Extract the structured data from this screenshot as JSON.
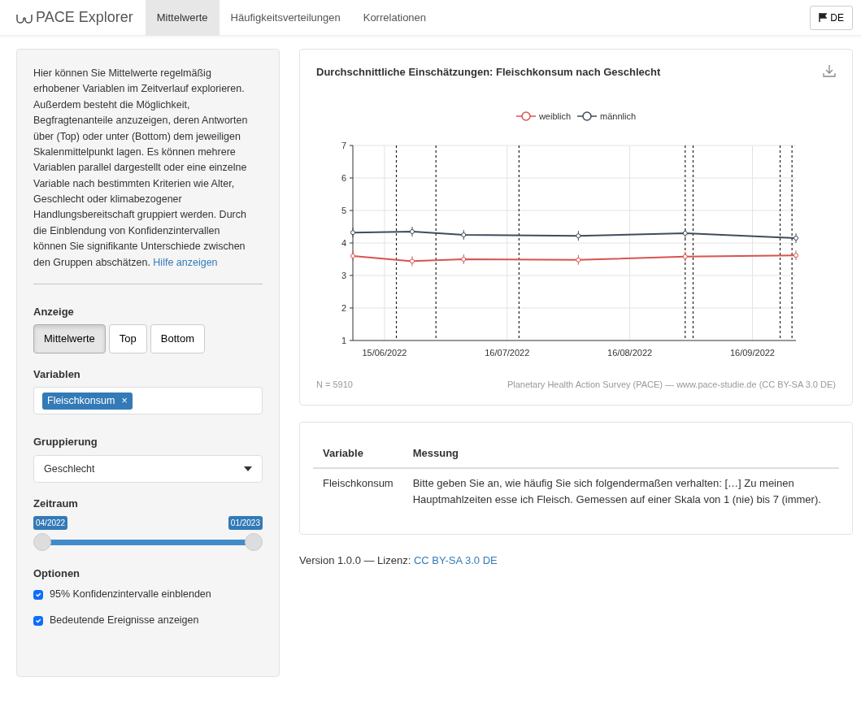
{
  "navbar": {
    "brand": "PACE Explorer",
    "tabs": [
      {
        "label": "Mittelwerte",
        "selected": true
      },
      {
        "label": "Häufigkeitsverteilungen",
        "selected": false
      },
      {
        "label": "Korrelationen",
        "selected": false
      }
    ],
    "language_button": "DE"
  },
  "sidebar": {
    "intro": "Hier können Sie Mittelwerte regelmäßig erhobener Variablen im Zeitverlauf explorieren. Außerdem besteht die Möglichkeit, Begfragtenanteile anzuzeigen, deren Antworten über (Top) oder unter (Bottom) dem jeweiligen Skalenmittelpunkt lagen. Es können mehrere Variablen parallel dargestellt oder eine einzelne Variable nach bestimmten Kriterien wie Alter, Geschlecht oder klimabezogener Handlungsbereitschaft gruppiert werden. Durch die Einblendung von Konfidenzintervallen können Sie signifikante Unterschiede zwischen den Gruppen abschätzen.",
    "help_link": "Hilfe anzeigen",
    "display": {
      "label": "Anzeige",
      "options": [
        {
          "label": "Mittelwerte",
          "selected": true
        },
        {
          "label": "Top",
          "selected": false
        },
        {
          "label": "Bottom",
          "selected": false
        }
      ]
    },
    "variables": {
      "label": "Variablen",
      "tags": [
        {
          "label": "Fleischkonsum",
          "remove": "×"
        }
      ]
    },
    "grouping": {
      "label": "Gruppierung",
      "value": "Geschlecht"
    },
    "period": {
      "label": "Zeitraum",
      "handles": [
        {
          "label": "04/2022",
          "level": 0
        },
        {
          "label": "01/2023",
          "level": 1
        }
      ]
    },
    "options": {
      "label": "Optionen",
      "items": [
        {
          "label": "95% Konfidenzintervalle einblenden",
          "checked": true
        },
        {
          "label": "Bedeutende Ereignisse anzeigen",
          "checked": true
        }
      ]
    }
  },
  "chart_card": {
    "title": "Durchschnittliche Einschätzungen: Fleischkonsum nach Geschlecht",
    "sample": "N = 5910",
    "source": "Planetary Health Action Survey (PACE) — www.pace-studie.de (CC BY-SA 3.0 DE)",
    "chart_data": {
      "type": "line",
      "grid": true,
      "x": [
        "2022-06-07",
        "2022-06-22",
        "2022-07-05",
        "2022-08-03",
        "2022-08-30",
        "2022-09-27"
      ],
      "series": [
        {
          "name": "weiblich",
          "color": "#d9534f",
          "marker": "circle",
          "values": [
            3.6,
            3.44,
            3.5,
            3.48,
            3.58,
            3.62
          ]
        },
        {
          "name": "männlich",
          "color": "#3e4d5c",
          "marker": "circle",
          "values": [
            4.32,
            4.35,
            4.25,
            4.22,
            4.3,
            4.15
          ]
        }
      ],
      "xlim": [
        "2022-06-07",
        "2022-09-27"
      ],
      "ylim": [
        1,
        7
      ],
      "xticks": [
        {
          "value": "2022-06-15",
          "label": "15/06/2022"
        },
        {
          "value": "2022-07-16",
          "label": "16/07/2022"
        },
        {
          "value": "2022-08-16",
          "label": "16/08/2022"
        },
        {
          "value": "2022-09-16",
          "label": "16/09/2022"
        }
      ],
      "yticks": [
        1,
        2,
        3,
        4,
        5,
        6,
        7
      ],
      "ref_lines": [
        {
          "axis": "x",
          "value": "2022-06-18"
        },
        {
          "axis": "x",
          "value": "2022-06-28"
        },
        {
          "axis": "x",
          "value": "2022-07-19"
        },
        {
          "axis": "x",
          "value": "2022-08-30"
        },
        {
          "axis": "x",
          "value": "2022-09-01"
        },
        {
          "axis": "x",
          "value": "2022-09-23"
        },
        {
          "axis": "x",
          "value": "2022-09-26"
        }
      ]
    }
  },
  "info_table": {
    "columns": [
      "Variable",
      "Messung"
    ],
    "rows": [
      [
        "Fleischkonsum",
        "Bitte geben Sie an, wie häufig Sie sich folgendermaßen verhalten: […] Zu meinen Hauptmahlzeiten esse ich Fleisch. Gemessen auf einer Skala von 1 (nie) bis 7 (immer)."
      ]
    ]
  },
  "footer": {
    "version": "Version 1.0.0 — Lizenz:",
    "license_link": "CC BY-SA 3.0 DE"
  }
}
